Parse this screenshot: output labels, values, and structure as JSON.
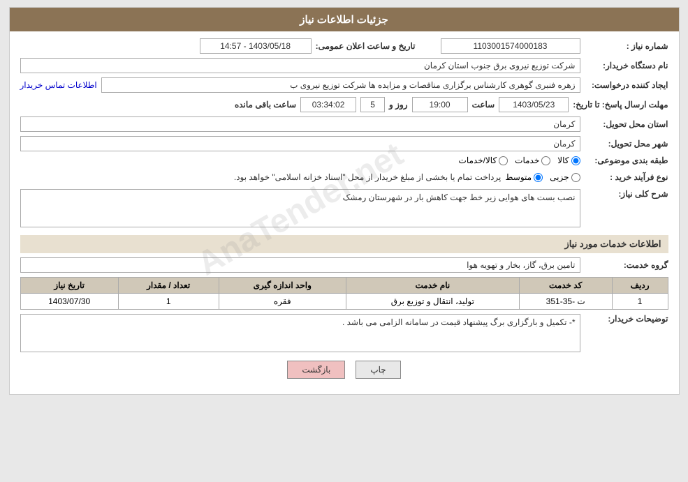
{
  "header": {
    "title": "جزئیات اطلاعات نیاز"
  },
  "fields": {
    "shomara_niaz_label": "شماره نیاز :",
    "shomara_niaz_value": "1103001574000183",
    "nam_dastgah_label": "نام دستگاه خریدار:",
    "nam_dastgah_value": "شرکت توزیع نیروی برق جنوب استان کرمان",
    "date_label": "تاریخ و ساعت اعلان عمومی:",
    "date_value": "1403/05/18 - 14:57",
    "ijad_label": "ایجاد کننده درخواست:",
    "ijad_value": "زهره فنبری گوهری کارشناس برگزاری مناقصات و مزایده ها شرکت توزیع نیروی ب",
    "ijad_link": "اطلاعات تماس خریدار",
    "mohlat_label": "مهلت ارسال پاسخ: تا تاریخ:",
    "mohlat_date": "1403/05/23",
    "mohlat_saat_label": "ساعت",
    "mohlat_saat": "19:00",
    "mohlat_rooz_label": "روز و",
    "mohlat_rooz": "5",
    "mohlat_remain_label": "ساعت باقی مانده",
    "mohlat_remain": "03:34:02",
    "ostan_label": "استان محل تحویل:",
    "ostan_value": "کرمان",
    "shahr_label": "شهر محل تحویل:",
    "shahr_value": "کرمان",
    "tabaghebandi_label": "طبقه بندی موضوعی:",
    "radio_kala": "کالا",
    "radio_khadamat": "خدمات",
    "radio_kala_khadamat": "کالا/خدمات",
    "noeFarayand_label": "نوع فرآیند خرید :",
    "radio_jozbii": "جزیی",
    "radio_motawaset": "متوسط",
    "noeFarayand_desc": "پرداخت تمام یا بخشی از مبلغ خریدار از محل \"اسناد خزانه اسلامی\" خواهد بود.",
    "sharh_label": "شرح کلی نیاز:",
    "sharh_value": "نصب بست های هوایی زیر خط جهت کاهش بار در شهرستان رمشک",
    "services_section": "اطلاعات خدمات مورد نیاز",
    "grooh_label": "گروه خدمت:",
    "grooh_value": "تامین برق، گاز، بخار و تهویه هوا",
    "table": {
      "headers": [
        "ردیف",
        "کد خدمت",
        "نام خدمت",
        "واحد اندازه گیری",
        "تعداد / مقدار",
        "تاریخ نیاز"
      ],
      "rows": [
        {
          "radif": "1",
          "kod": "ت -35-351",
          "name": "تولید، انتقال و توزیع برق",
          "vahed": "فقره",
          "tedad": "1",
          "tarikh": "1403/07/30"
        }
      ]
    },
    "tosif_label": "توضیحات خریدار:",
    "tosif_value": "*- تکمیل و بارگزاری برگ پیشنهاد قیمت در سامانه الزامی می باشد .",
    "btn_print": "چاپ",
    "btn_back": "بازگشت"
  }
}
